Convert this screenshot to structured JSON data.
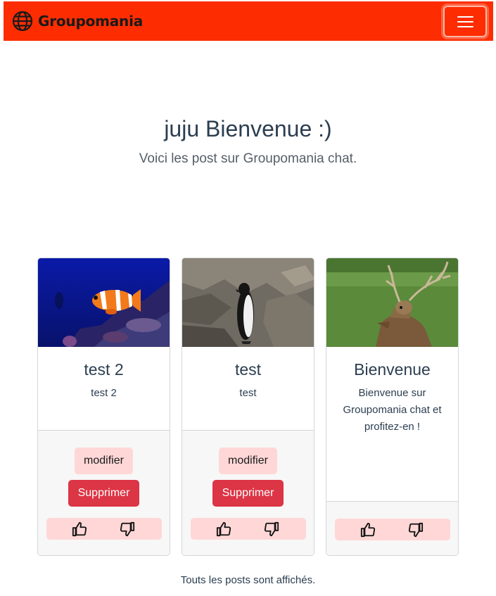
{
  "navbar": {
    "brand": "Groupomania",
    "brand_icon": "globe-icon",
    "toggler_icon": "hamburger-icon",
    "colors": {
      "background": "#fd2d01",
      "brand_text": "#1a1a1a"
    }
  },
  "welcome": {
    "title": "juju Bienvenue :)",
    "subtitle": "Voici les post sur Groupomania chat."
  },
  "posts": [
    {
      "image": "clownfish-aquarium-photo",
      "title": "test 2",
      "text": "test 2",
      "edit_label": "modifier",
      "delete_label": "Supprimer",
      "like_icon": "thumbs-up-icon",
      "dislike_icon": "thumbs-down-icon"
    },
    {
      "image": "penguin-on-rocks-photo",
      "title": "test",
      "text": "test",
      "edit_label": "modifier",
      "delete_label": "Supprimer",
      "like_icon": "thumbs-up-icon",
      "dislike_icon": "thumbs-down-icon"
    },
    {
      "image": "deer-in-meadow-photo",
      "title": "Bienvenue",
      "text": "Bienvenue sur Groupomania chat et profitez-en !",
      "like_icon": "thumbs-up-icon",
      "dislike_icon": "thumbs-down-icon"
    }
  ],
  "footer": {
    "message": "Touts les posts sont affichés."
  },
  "colors": {
    "edit_button": "#ffd7d7",
    "delete_button": "#dc3545",
    "reaction_bar": "#ffd7d7"
  }
}
